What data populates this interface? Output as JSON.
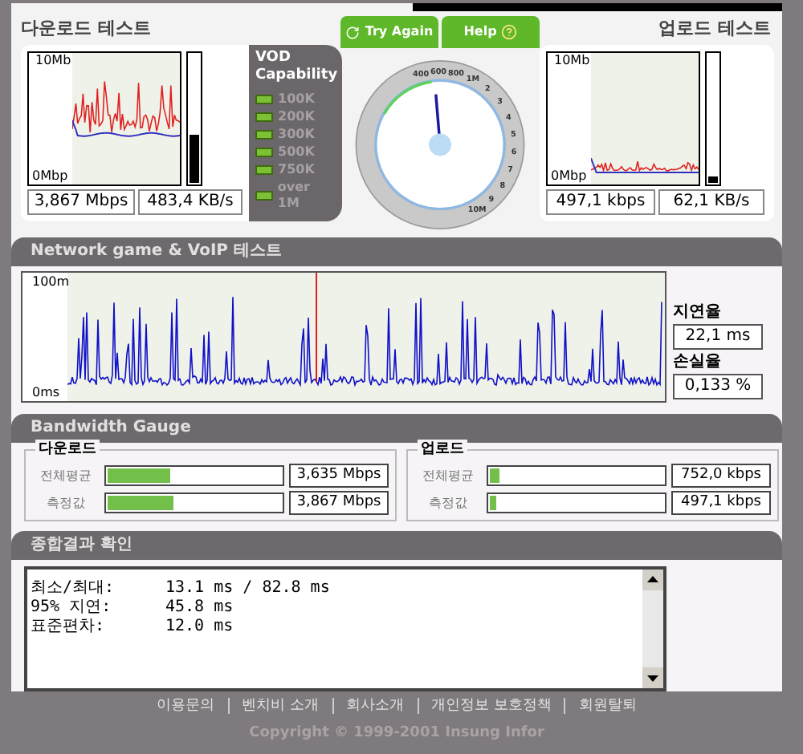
{
  "download": {
    "title": "다운로드 테스트",
    "axis_top": "10Mb",
    "axis_bottom": "0Mbp",
    "meter": {
      "level": 0.38
    },
    "speed": "3,867 Mbps",
    "rate": "483,4 KB/s"
  },
  "vod": {
    "title": "VOD Capability",
    "items": [
      {
        "label": "100K"
      },
      {
        "label": "200K"
      },
      {
        "label": "300K"
      },
      {
        "label": "500K"
      },
      {
        "label": "750K"
      },
      {
        "label": "over 1M"
      }
    ]
  },
  "buttons": [
    {
      "label": "Try Again",
      "kind": "refresh"
    },
    {
      "label": "Help",
      "kind": "help"
    }
  ],
  "dial_labels": [
    "400",
    "600",
    "800",
    "1M",
    "2",
    "3",
    "4",
    "5",
    "6",
    "7",
    "8",
    "9",
    "10M"
  ],
  "upload": {
    "title": "업로드 테스트",
    "axis_top": "10Mb",
    "axis_bottom": "0Mbp",
    "meter": {
      "level": 0.05
    },
    "speed": "497,1 kbps",
    "rate": "62,1 KB/s"
  },
  "voip": {
    "title": "Network game & VoIP 테스트",
    "axis_top": "100m",
    "axis_bottom": "0ms",
    "latency_label": "지연율",
    "latency": "22,1 ms",
    "loss_label": "손실율",
    "loss": "0,133 %"
  },
  "bandwidth": {
    "title": "Bandwidth Gauge",
    "groups": [
      {
        "title": "다운로드",
        "rows": [
          {
            "label": "전체평균",
            "level": 0.36,
            "value": "3,635 Mbps"
          },
          {
            "label": "측정값",
            "level": 0.38,
            "value": "3,867 Mbps"
          }
        ]
      },
      {
        "title": "업로드",
        "rows": [
          {
            "label": "전체평균",
            "level": 0.06,
            "value": "752,0 kbps"
          },
          {
            "label": "측정값",
            "level": 0.04,
            "value": "497,1 kbps"
          }
        ]
      }
    ]
  },
  "results": {
    "title": "종합결과 확인",
    "lines": [
      {
        "label": "최소/최대:",
        "value": "13.1 ms / 82.8 ms"
      },
      {
        "label": "95% 지연:",
        "value": "45.8 ms"
      },
      {
        "label": "표준편차:",
        "value": "12.0 ms"
      }
    ]
  },
  "footer": {
    "links": [
      "이용문의",
      "벤치비 소개",
      "회사소개",
      "개인정보 보호정책",
      "회원탈퇴"
    ],
    "copyright": "Copyright © 1999-2001 Insung Infor"
  }
}
